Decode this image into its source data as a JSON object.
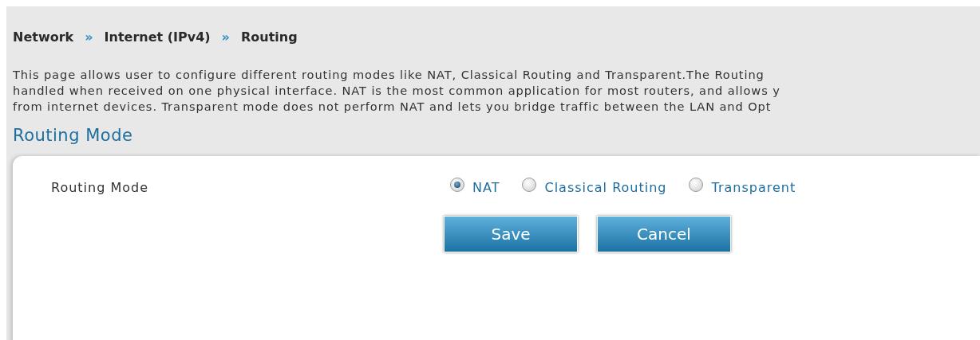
{
  "breadcrumb": [
    {
      "label": "Network"
    },
    {
      "label": "Internet (IPv4)"
    },
    {
      "label": "Routing"
    }
  ],
  "breadcrumb_separators": [
    "»",
    "»"
  ],
  "description_lines": [
    "This page allows user to configure different routing modes like NAT, Classical Routing and Transparent.The Routing",
    "handled when received on one physical interface. NAT is the most common application for most routers, and allows y",
    "from internet devices. Transparent mode does not perform NAT and lets you bridge traffic between the LAN and Opt"
  ],
  "section_title": "Routing Mode",
  "form": {
    "label": "Routing Mode",
    "options": [
      {
        "label": "NAT",
        "selected": true
      },
      {
        "label": "Classical Routing",
        "selected": false
      },
      {
        "label": "Transparent",
        "selected": false
      }
    ]
  },
  "buttons": [
    "Save",
    "Cancel"
  ]
}
